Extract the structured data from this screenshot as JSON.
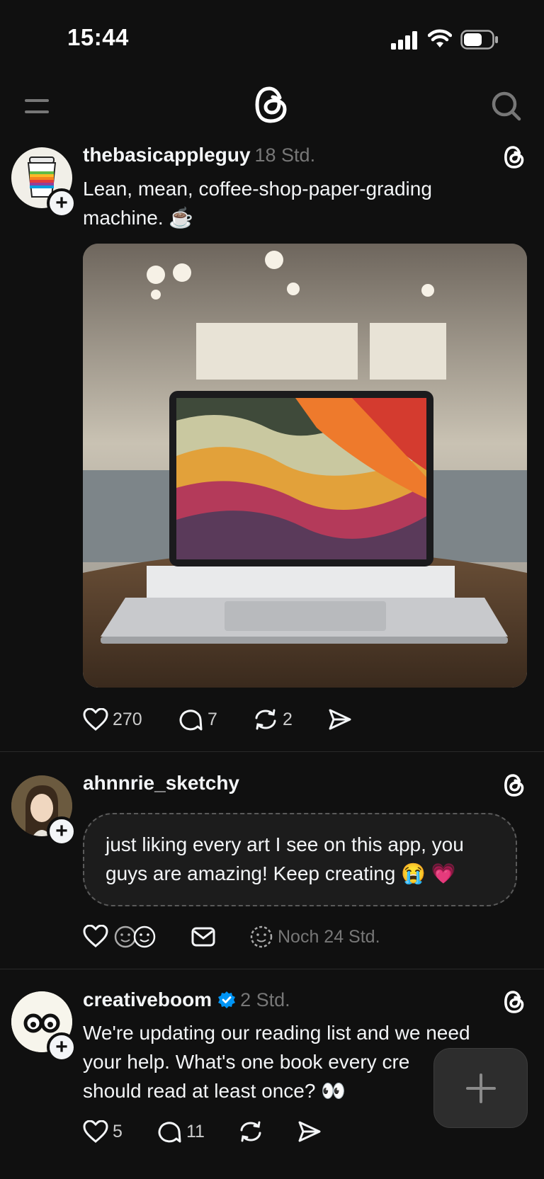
{
  "status_bar": {
    "time": "15:44"
  },
  "header": {
    "menu_icon": "menu-icon",
    "logo_icon": "threads-logo-icon",
    "search_icon": "search-icon"
  },
  "posts": [
    {
      "username": "thebasicappleguy",
      "time": "18 Std.",
      "text_line1": "Lean, mean, coffee-shop-paper-grading",
      "text_line2": "machine. ☕",
      "likes": "270",
      "replies": "7",
      "reposts": "2"
    },
    {
      "username": "ahnnrie_sketchy",
      "note_line1": "just liking every art I see on this app, you",
      "note_line2": "guys are amazing! Keep creating 😭 💗",
      "expires": "Noch 24 Std."
    },
    {
      "username": "creativeboom",
      "time": "2 Std.",
      "verified": true,
      "text_line1": "We're updating our reading list and we need",
      "text_line2": "your help. What's one book every cre",
      "text_line3": "should read at least once? 👀",
      "likes": "5",
      "replies": "11"
    }
  ],
  "colors": {
    "background": "#101010",
    "text": "#f3f5f7",
    "muted": "#777777",
    "verified": "#0095f6"
  }
}
